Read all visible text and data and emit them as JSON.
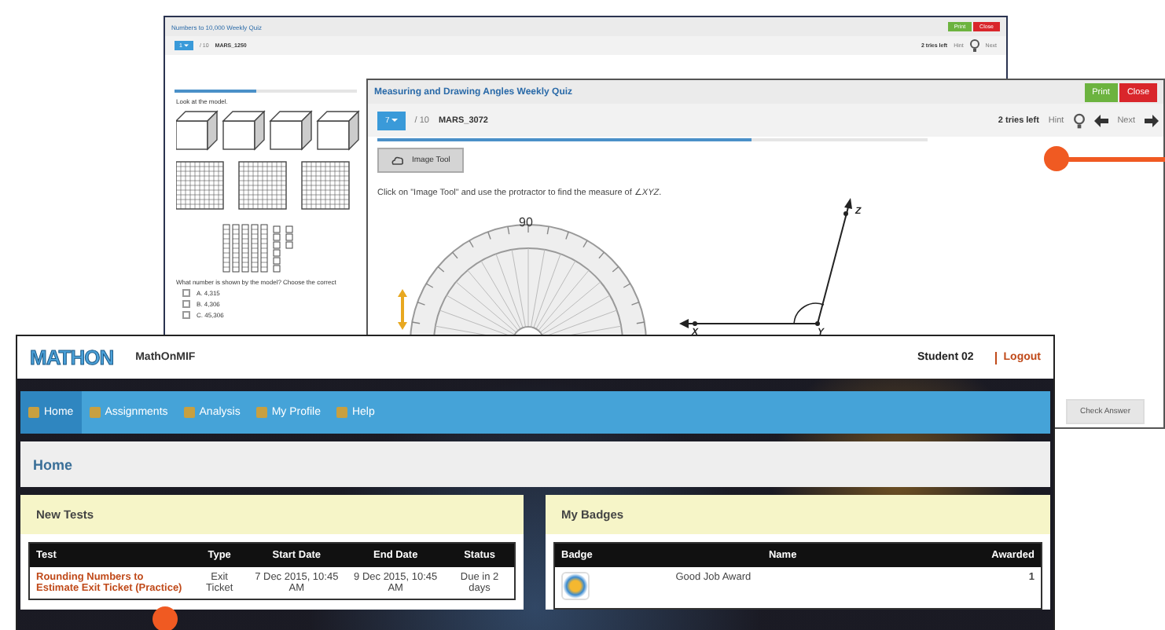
{
  "back_quiz": {
    "title": "Numbers to 10,000 Weekly Quiz",
    "buttons": [
      {
        "label": "Print",
        "kind": "print"
      },
      {
        "label": "Close",
        "kind": "close"
      }
    ],
    "question_number": "1",
    "total": "/ 10",
    "code": "MARS_1250",
    "tries": "2 tries left",
    "hint": "Hint",
    "next": "Next",
    "progress": {
      "level": 0.45
    },
    "prompt": "Look at the model.",
    "question": "What number is shown by the model? Choose the correct",
    "options": [
      {
        "letter": "A.",
        "value": "4,315",
        "selected": false
      },
      {
        "letter": "B.",
        "value": "4,306",
        "selected": false
      },
      {
        "letter": "C.",
        "value": "45,306",
        "selected": false
      }
    ]
  },
  "front_quiz": {
    "title": "Measuring and Drawing Angles Weekly Quiz",
    "buttons": [
      {
        "label": "Print",
        "kind": "print"
      },
      {
        "label": "Close",
        "kind": "close"
      }
    ],
    "question_number": "7",
    "total": "/ 10",
    "code": "MARS_3072",
    "tries": "2 tries left",
    "hint": "Hint",
    "next": "Next",
    "progress": {
      "level": 0.68
    },
    "image_tool": "Image Tool",
    "instruction": "Click on \"Image Tool\" and use the protractor to find the measure of ∠*XYZ*.",
    "protractor_label": "90",
    "points": [
      "X",
      "Y",
      "Z"
    ],
    "check_answer": "Check Answer"
  },
  "app": {
    "logo": "MATHON",
    "name": "MathOnMIF",
    "user": "Student 02",
    "logout": "Logout",
    "nav": [
      {
        "label": "Home",
        "selected": true
      },
      {
        "label": "Assignments",
        "selected": false
      },
      {
        "label": "Analysis",
        "selected": false
      },
      {
        "label": "My Profile",
        "selected": false
      },
      {
        "label": "Help",
        "selected": false
      }
    ],
    "page_title": "Home",
    "new_tests": {
      "title": "New Tests",
      "columns": [
        "Test",
        "Type",
        "Start Date",
        "End Date",
        "Status"
      ],
      "rows": [
        {
          "test": "Rounding Numbers to Estimate Exit Ticket (Practice)",
          "type": "Exit Ticket",
          "start": "7 Dec 2015, 10:45 AM",
          "end": "9 Dec 2015, 10:45 AM",
          "status": "Due in 2 days"
        }
      ]
    },
    "badges": {
      "title": "My Badges",
      "columns": [
        "Badge",
        "Name",
        "Awarded"
      ],
      "rows": [
        {
          "name": "Good Job Award",
          "awarded": "1"
        }
      ]
    }
  }
}
